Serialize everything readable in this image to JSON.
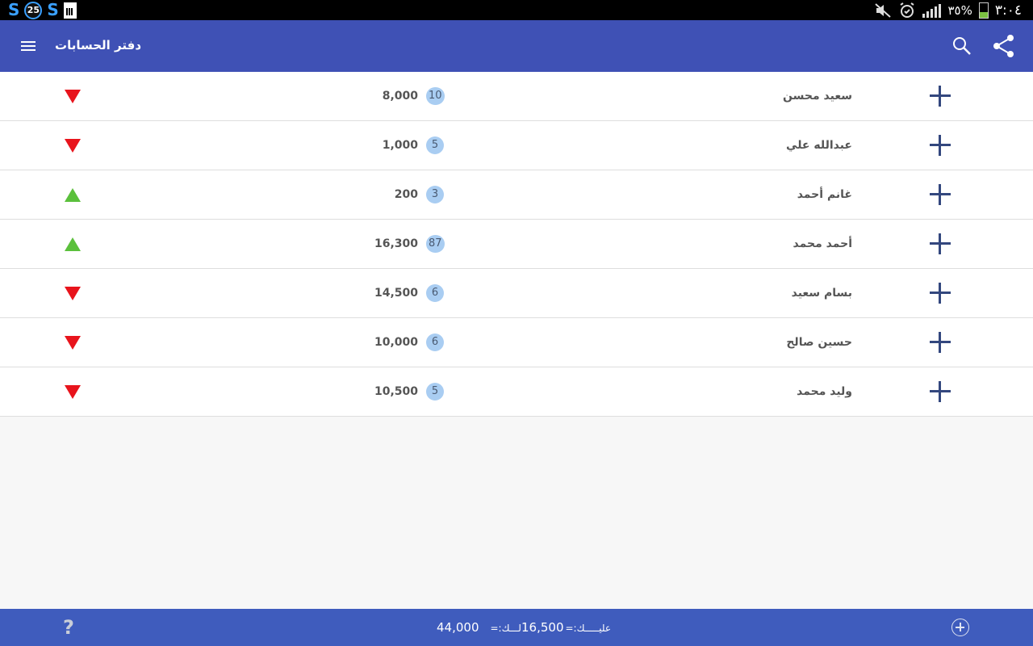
{
  "status_bar": {
    "time": "٣:٠٤",
    "battery_percent": "٣٥%",
    "badge_number": "25",
    "left_icons": [
      "s-logo-icon",
      "notification-count-icon",
      "s-logo-icon",
      "sim-card-icon"
    ],
    "right_icons": [
      "mute-icon",
      "alarm-icon",
      "signal-icon",
      "battery-icon"
    ]
  },
  "app_bar": {
    "title": "دفتر الحسابات",
    "color": "#3f51b5",
    "icons": [
      "menu-icon",
      "search-icon",
      "share-icon"
    ]
  },
  "accounts": [
    {
      "name": "سعيد محسن",
      "count": "10",
      "amount": "8,000",
      "direction": "down"
    },
    {
      "name": "عبدالله علي",
      "count": "5",
      "amount": "1,000",
      "direction": "down"
    },
    {
      "name": "غانم أحمد",
      "count": "3",
      "amount": "200",
      "direction": "up"
    },
    {
      "name": "أحمد محمد",
      "count": "87",
      "amount": "16,300",
      "direction": "up"
    },
    {
      "name": "بسام سعيد",
      "count": "6",
      "amount": "14,500",
      "direction": "down"
    },
    {
      "name": "حسين صالح",
      "count": "6",
      "amount": "10,000",
      "direction": "down"
    },
    {
      "name": "وليد محمد",
      "count": "5",
      "amount": "10,500",
      "direction": "down"
    }
  ],
  "colors": {
    "arrow_down": "#e8141c",
    "arrow_up": "#5bc03c",
    "plus": "#33477e",
    "badge_bg": "#a9cdf2"
  },
  "bottom_bar": {
    "help": "?",
    "total_alayk_label": "عليـــــك:=",
    "total_alayk_value": "16,500",
    "total_lak_label": "لـــك:=",
    "total_lak_value": "44,000"
  }
}
